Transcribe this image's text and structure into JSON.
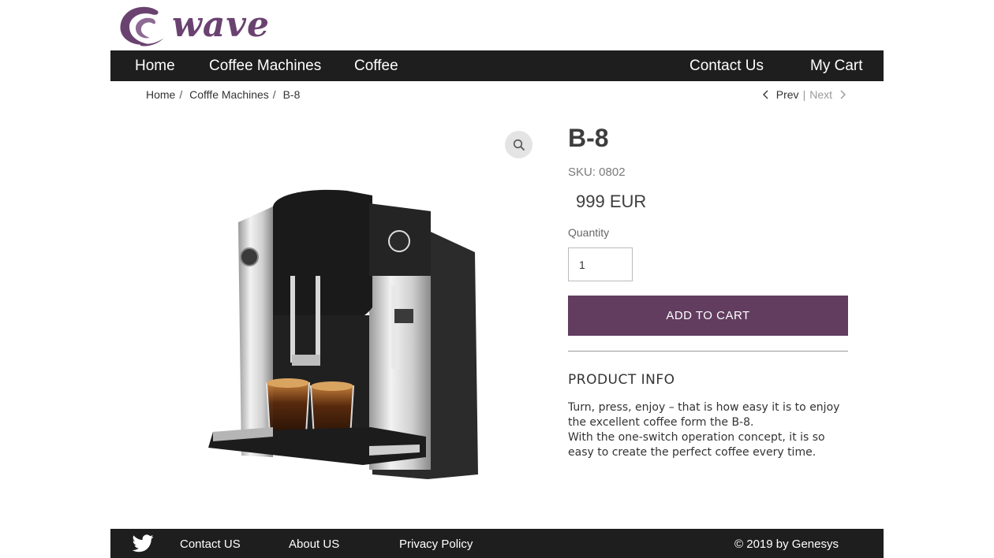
{
  "brand": {
    "logo_text": "wave",
    "logo_color": "#6a4270"
  },
  "nav": {
    "items": [
      {
        "label": "Home"
      },
      {
        "label": "Coffee Machines"
      },
      {
        "label": "Coffee"
      },
      {
        "label": "Contact Us"
      },
      {
        "label": "My Cart"
      }
    ]
  },
  "breadcrumb": [
    {
      "label": "Home"
    },
    {
      "label": "Cofffe Machines"
    },
    {
      "label": "B-8"
    }
  ],
  "pager": {
    "prev": "Prev",
    "divider": "|",
    "next": "Next"
  },
  "product": {
    "title": "B-8",
    "sku": "SKU: 0802",
    "price": "999 EUR",
    "quantity_label": "Quantity",
    "quantity_value": "1",
    "add_to_cart": "ADD TO CART",
    "info_title": "PRODUCT INFO",
    "description_line1": "Turn, press, enjoy – that is how easy it is to enjoy the excellent coffee form the B-8.",
    "description_line2": "With the one-switch operation concept, it is so easy to create the perfect coffee every time."
  },
  "footer": {
    "links": [
      {
        "label": "Contact US"
      },
      {
        "label": "About US"
      },
      {
        "label": "Privacy Policy"
      }
    ],
    "copyright": "© 2019 by Genesys"
  },
  "colors": {
    "accent": "#623d60",
    "bar": "#1e1e1e"
  },
  "icons": [
    "wave-logo-icon",
    "search-zoom-icon",
    "chevron-left-icon",
    "chevron-right-icon",
    "twitter-icon"
  ]
}
